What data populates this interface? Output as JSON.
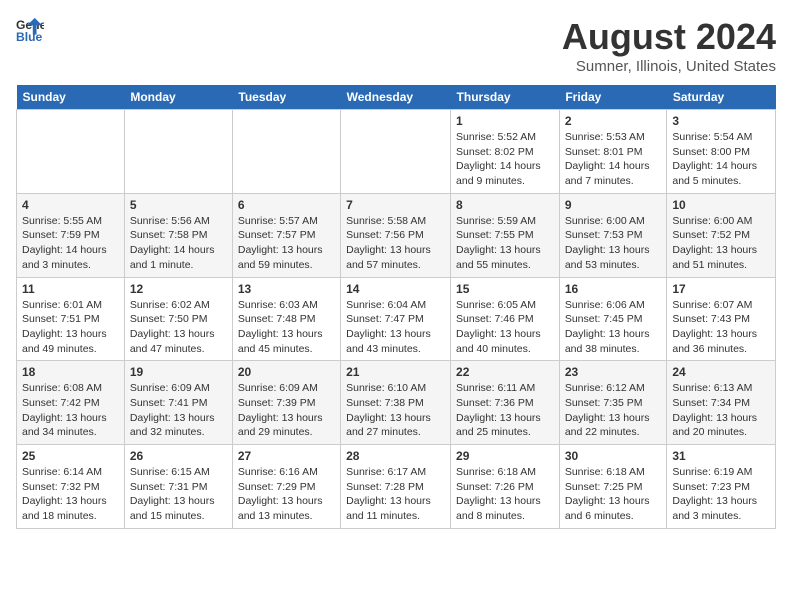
{
  "header": {
    "logo_line1": "General",
    "logo_line2": "Blue",
    "main_title": "August 2024",
    "subtitle": "Sumner, Illinois, United States"
  },
  "days_of_week": [
    "Sunday",
    "Monday",
    "Tuesday",
    "Wednesday",
    "Thursday",
    "Friday",
    "Saturday"
  ],
  "weeks": [
    {
      "days": [
        {
          "num": "",
          "info": ""
        },
        {
          "num": "",
          "info": ""
        },
        {
          "num": "",
          "info": ""
        },
        {
          "num": "",
          "info": ""
        },
        {
          "num": "1",
          "info": "Sunrise: 5:52 AM\nSunset: 8:02 PM\nDaylight: 14 hours\nand 9 minutes."
        },
        {
          "num": "2",
          "info": "Sunrise: 5:53 AM\nSunset: 8:01 PM\nDaylight: 14 hours\nand 7 minutes."
        },
        {
          "num": "3",
          "info": "Sunrise: 5:54 AM\nSunset: 8:00 PM\nDaylight: 14 hours\nand 5 minutes."
        }
      ]
    },
    {
      "days": [
        {
          "num": "4",
          "info": "Sunrise: 5:55 AM\nSunset: 7:59 PM\nDaylight: 14 hours\nand 3 minutes."
        },
        {
          "num": "5",
          "info": "Sunrise: 5:56 AM\nSunset: 7:58 PM\nDaylight: 14 hours\nand 1 minute."
        },
        {
          "num": "6",
          "info": "Sunrise: 5:57 AM\nSunset: 7:57 PM\nDaylight: 13 hours\nand 59 minutes."
        },
        {
          "num": "7",
          "info": "Sunrise: 5:58 AM\nSunset: 7:56 PM\nDaylight: 13 hours\nand 57 minutes."
        },
        {
          "num": "8",
          "info": "Sunrise: 5:59 AM\nSunset: 7:55 PM\nDaylight: 13 hours\nand 55 minutes."
        },
        {
          "num": "9",
          "info": "Sunrise: 6:00 AM\nSunset: 7:53 PM\nDaylight: 13 hours\nand 53 minutes."
        },
        {
          "num": "10",
          "info": "Sunrise: 6:00 AM\nSunset: 7:52 PM\nDaylight: 13 hours\nand 51 minutes."
        }
      ]
    },
    {
      "days": [
        {
          "num": "11",
          "info": "Sunrise: 6:01 AM\nSunset: 7:51 PM\nDaylight: 13 hours\nand 49 minutes."
        },
        {
          "num": "12",
          "info": "Sunrise: 6:02 AM\nSunset: 7:50 PM\nDaylight: 13 hours\nand 47 minutes."
        },
        {
          "num": "13",
          "info": "Sunrise: 6:03 AM\nSunset: 7:48 PM\nDaylight: 13 hours\nand 45 minutes."
        },
        {
          "num": "14",
          "info": "Sunrise: 6:04 AM\nSunset: 7:47 PM\nDaylight: 13 hours\nand 43 minutes."
        },
        {
          "num": "15",
          "info": "Sunrise: 6:05 AM\nSunset: 7:46 PM\nDaylight: 13 hours\nand 40 minutes."
        },
        {
          "num": "16",
          "info": "Sunrise: 6:06 AM\nSunset: 7:45 PM\nDaylight: 13 hours\nand 38 minutes."
        },
        {
          "num": "17",
          "info": "Sunrise: 6:07 AM\nSunset: 7:43 PM\nDaylight: 13 hours\nand 36 minutes."
        }
      ]
    },
    {
      "days": [
        {
          "num": "18",
          "info": "Sunrise: 6:08 AM\nSunset: 7:42 PM\nDaylight: 13 hours\nand 34 minutes."
        },
        {
          "num": "19",
          "info": "Sunrise: 6:09 AM\nSunset: 7:41 PM\nDaylight: 13 hours\nand 32 minutes."
        },
        {
          "num": "20",
          "info": "Sunrise: 6:09 AM\nSunset: 7:39 PM\nDaylight: 13 hours\nand 29 minutes."
        },
        {
          "num": "21",
          "info": "Sunrise: 6:10 AM\nSunset: 7:38 PM\nDaylight: 13 hours\nand 27 minutes."
        },
        {
          "num": "22",
          "info": "Sunrise: 6:11 AM\nSunset: 7:36 PM\nDaylight: 13 hours\nand 25 minutes."
        },
        {
          "num": "23",
          "info": "Sunrise: 6:12 AM\nSunset: 7:35 PM\nDaylight: 13 hours\nand 22 minutes."
        },
        {
          "num": "24",
          "info": "Sunrise: 6:13 AM\nSunset: 7:34 PM\nDaylight: 13 hours\nand 20 minutes."
        }
      ]
    },
    {
      "days": [
        {
          "num": "25",
          "info": "Sunrise: 6:14 AM\nSunset: 7:32 PM\nDaylight: 13 hours\nand 18 minutes."
        },
        {
          "num": "26",
          "info": "Sunrise: 6:15 AM\nSunset: 7:31 PM\nDaylight: 13 hours\nand 15 minutes."
        },
        {
          "num": "27",
          "info": "Sunrise: 6:16 AM\nSunset: 7:29 PM\nDaylight: 13 hours\nand 13 minutes."
        },
        {
          "num": "28",
          "info": "Sunrise: 6:17 AM\nSunset: 7:28 PM\nDaylight: 13 hours\nand 11 minutes."
        },
        {
          "num": "29",
          "info": "Sunrise: 6:18 AM\nSunset: 7:26 PM\nDaylight: 13 hours\nand 8 minutes."
        },
        {
          "num": "30",
          "info": "Sunrise: 6:18 AM\nSunset: 7:25 PM\nDaylight: 13 hours\nand 6 minutes."
        },
        {
          "num": "31",
          "info": "Sunrise: 6:19 AM\nSunset: 7:23 PM\nDaylight: 13 hours\nand 3 minutes."
        }
      ]
    }
  ]
}
